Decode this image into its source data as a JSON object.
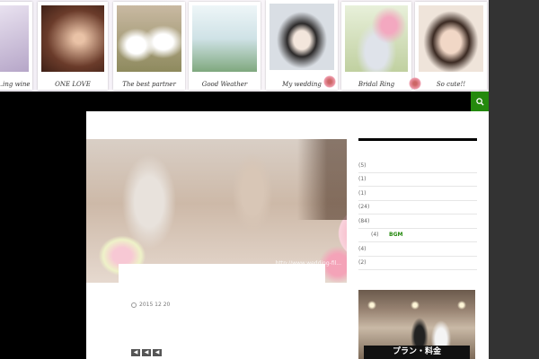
{
  "header": {
    "photos": [
      {
        "caption": "...ing wine",
        "colors": [
          "#d9d0e6",
          "#b8a7c9"
        ]
      },
      {
        "caption": "ONE LOVE",
        "colors": [
          "#6a3b2a",
          "#b7826a"
        ]
      },
      {
        "caption": "The best partner",
        "colors": [
          "#c8b8a0",
          "#8a8a5c"
        ]
      },
      {
        "caption": "Good Weather",
        "colors": [
          "#e2eef2",
          "#8fb59a"
        ]
      },
      {
        "caption": "My wedding",
        "colors": [
          "#d6dce2",
          "#9aa6b0"
        ]
      },
      {
        "caption": "Bridal Ring",
        "colors": [
          "#e8f0d8",
          "#c8b8d0"
        ]
      },
      {
        "caption": "So cute!!",
        "colors": [
          "#f1e2d8",
          "#9b7b5f"
        ]
      }
    ]
  },
  "search": {
    "icon": "search-icon",
    "color": "#24890d"
  },
  "post": {
    "image_credit": "http://www.wedding-fil...",
    "date": "2015 12 20",
    "pager": [
      "◀",
      "◀",
      "◀"
    ]
  },
  "sidebar": {
    "items": [
      {
        "count": "(5)",
        "label": ""
      },
      {
        "count": "(1)",
        "label": ""
      },
      {
        "count": "(1)",
        "label": ""
      },
      {
        "count": "(24)",
        "label": ""
      },
      {
        "count": "(84)",
        "label": ""
      },
      {
        "count": "(4)",
        "label": "BGM",
        "sub": true
      },
      {
        "count": "(4)",
        "label": ""
      },
      {
        "count": "(2)",
        "label": ""
      }
    ],
    "widget_banner": "プラン・料金"
  },
  "colors": {
    "accent": "#24890d",
    "background": "#000000",
    "content": "#ffffff"
  }
}
